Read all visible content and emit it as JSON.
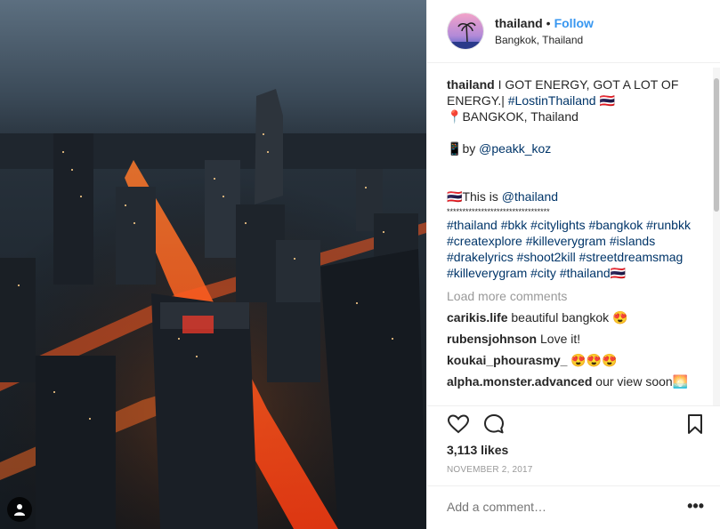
{
  "post": {
    "username": "thailand",
    "separator": "•",
    "follow_label": "Follow",
    "location": "Bangkok, Thailand"
  },
  "caption": {
    "username": "thailand",
    "line1": "I GOT ENERGY, GOT A LOT OF ENERGY.|",
    "hashtag_lost": "#LostinThailand",
    "flag": "🇹🇭",
    "location_pin": "📍",
    "location_text": "BANGKOK, Thailand",
    "photo_emoji": "📱",
    "by_text": "by",
    "by_user": "@peakk_koz",
    "this_is": "This is",
    "this_is_user": "@thailand",
    "stars": "*********************************",
    "hashtags": "#thailand #bkk #citylights #bangkok #runbkk #createxplore #killeverygram #islands #drakelyrics #shoot2kill #streetdreamsmag #killeverygram #city #thailand"
  },
  "load_more": "Load more comments",
  "comments": [
    {
      "user": "carikis.life",
      "text": "beautiful bangkok 😍"
    },
    {
      "user": "rubensjohnson",
      "text": "Love it!"
    },
    {
      "user": "koukai_phourasmy_",
      "text": "😍😍😍"
    },
    {
      "user": "alpha.monster.advanced",
      "text": "our view soon🌅"
    }
  ],
  "icons": {
    "like": "heart-icon",
    "comment": "comment-icon",
    "save": "bookmark-icon",
    "tag": "person-tag-icon",
    "more": "more-options-icon"
  },
  "likes_count": "3,113 likes",
  "date": "NOVEMBER 2, 2017",
  "add_comment_placeholder": "Add a comment…",
  "more_label": "•••",
  "colors": {
    "accent": "#3897f0",
    "text": "#262626",
    "muted": "#999999",
    "link": "#003569"
  }
}
